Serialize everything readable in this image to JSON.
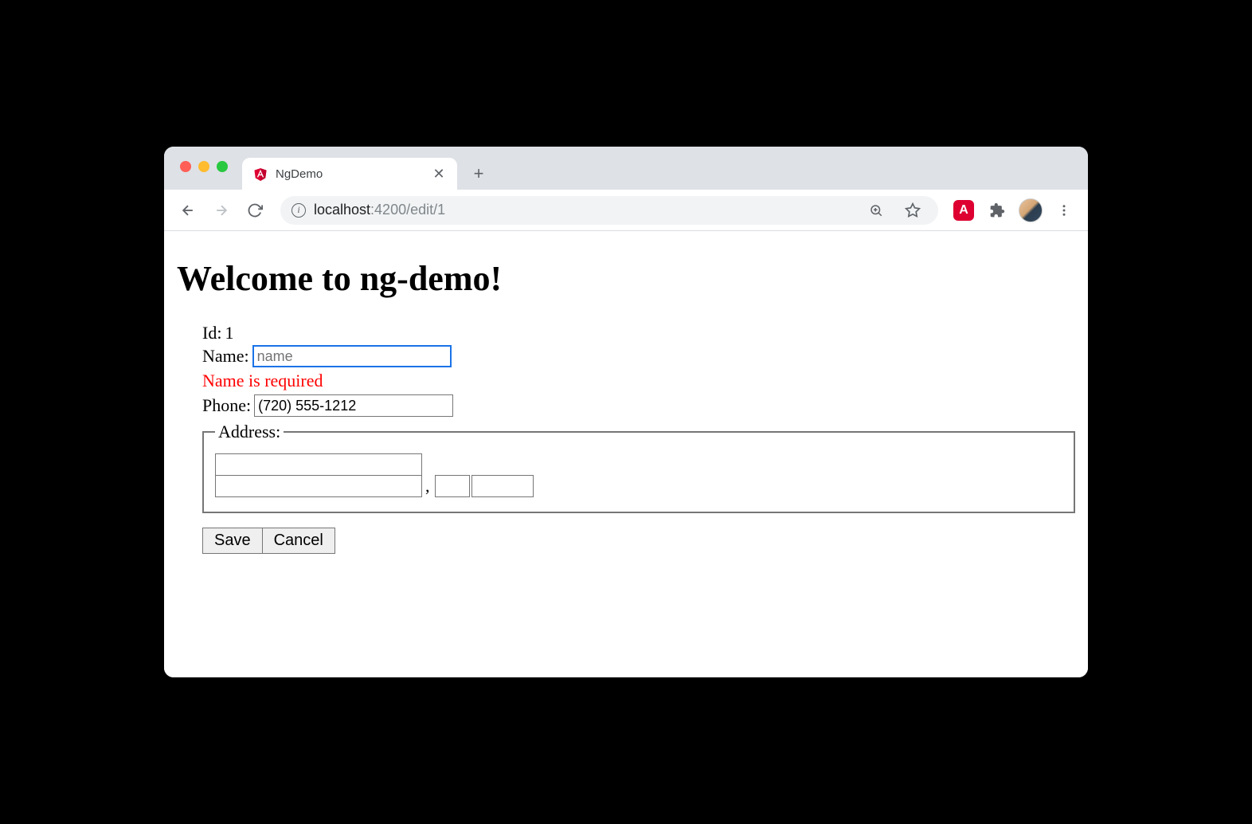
{
  "browser": {
    "tab": {
      "title": "NgDemo"
    },
    "url": {
      "host": "localhost",
      "port": ":4200",
      "path": "/edit/1"
    }
  },
  "page": {
    "heading": "Welcome to ng-demo!",
    "form": {
      "id_label": "Id:",
      "id_value": "1",
      "name_label": "Name:",
      "name_value": "",
      "name_placeholder": "name",
      "name_error": "Name is required",
      "phone_label": "Phone:",
      "phone_value": "(720) 555-1212",
      "address_legend": "Address:",
      "address": {
        "street": "",
        "city": "",
        "state": "",
        "zip": "",
        "separator": ","
      },
      "save_label": "Save",
      "cancel_label": "Cancel"
    }
  }
}
